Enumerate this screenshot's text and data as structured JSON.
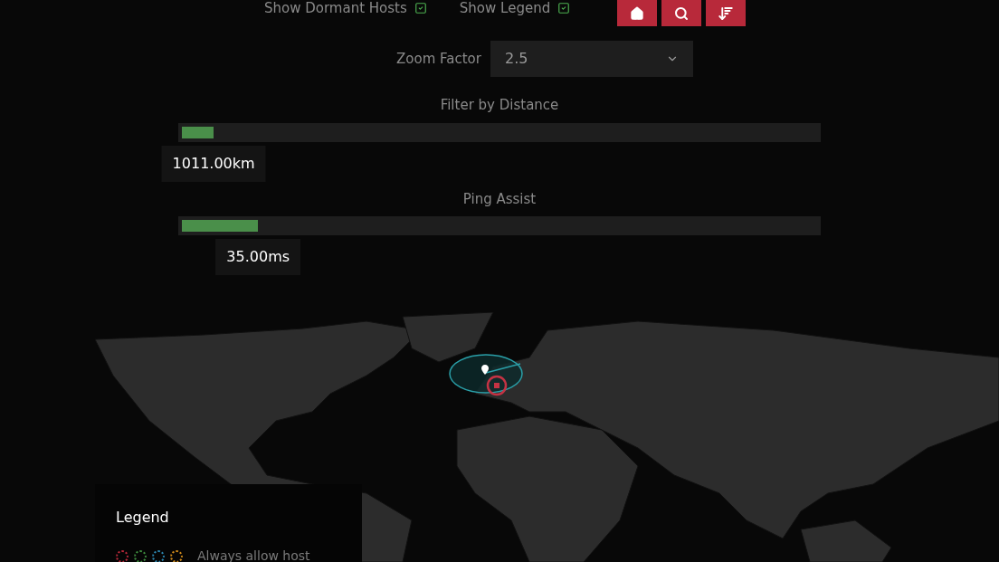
{
  "options": [
    {
      "label": "Show Dormant Hosts",
      "checked": true
    },
    {
      "label": "Show Legend",
      "checked": true
    }
  ],
  "zoom": {
    "label": "Zoom Factor",
    "value": "2.5"
  },
  "sliders": [
    {
      "title": "Filter by Distance",
      "level": 0.05,
      "reading": "1011.00km"
    },
    {
      "title": "Ping Assist",
      "level": 0.12,
      "reading": "35.00ms"
    }
  ],
  "legend": {
    "title": "Legend",
    "rows": [
      {
        "dots": [
          {
            "color": "#b8293a"
          },
          {
            "color": "#3e8b3e"
          },
          {
            "color": "#2c86b0"
          },
          {
            "color": "#d08a1a"
          }
        ],
        "label": "Always allow host"
      }
    ]
  }
}
